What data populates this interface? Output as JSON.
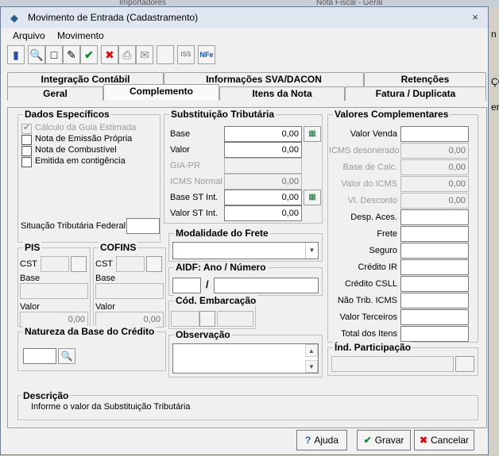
{
  "background": {
    "tabs": [
      "Importadores",
      "Nota Fiscal - Geral"
    ],
    "right_items": [
      "n",
      "ÇÕ",
      "en"
    ]
  },
  "window": {
    "title": "Movimento de Entrada (Cadastramento)",
    "close_glyph": "×"
  },
  "menu": {
    "items": [
      "Arquivo",
      "Movimento"
    ]
  },
  "toolbar": {
    "icons": [
      "book-icon",
      "search-icon",
      "new-document-icon",
      "edit-document-icon",
      "confirm-icon",
      "delete-icon",
      "print-icon",
      "mail-icon",
      "blank-icon",
      "iss-icon",
      "nfe-icon"
    ],
    "glyphs": [
      "▮",
      "🔍",
      "□",
      "✎",
      "✔",
      "✖",
      "⎙",
      "✉",
      "",
      "ISS",
      "NFe"
    ]
  },
  "tabs": {
    "row1": [
      "Integração Contábil",
      "Informações SVA/DACON",
      "Retenções"
    ],
    "row2": [
      "Geral",
      "Complemento",
      "Itens da Nota",
      "Fatura / Duplicata"
    ],
    "active": "Complemento"
  },
  "dados": {
    "title": "Dados Específicos",
    "checks": [
      {
        "label": "Cálculo da Guia Estimada",
        "checked": true,
        "disabled": true
      },
      {
        "label": "Nota de Emissão Própria",
        "checked": false,
        "disabled": false
      },
      {
        "label": "Nota de Combustível",
        "checked": false,
        "disabled": false
      },
      {
        "label": "Emitida em contigência",
        "checked": false,
        "disabled": false
      }
    ],
    "situacao_label": "Situação Tributária Federal",
    "situacao_value": ""
  },
  "pis": {
    "title": "PIS",
    "cst_label": "CST",
    "base_label": "Base",
    "valor_label": "Valor",
    "valor": "0,00"
  },
  "cofins": {
    "title": "COFINS",
    "cst_label": "CST",
    "base_label": "Base",
    "valor_label": "Valor",
    "valor": "0,00"
  },
  "natureza": {
    "title": "Natureza da Base do Crédito",
    "value": ""
  },
  "st": {
    "title": "Substituição Tributária",
    "rows": [
      {
        "label": "Base",
        "value": "0,00",
        "disabled": false,
        "calc": true
      },
      {
        "label": "Valor",
        "value": "0,00",
        "disabled": false,
        "calc": false
      },
      {
        "label": "GIA-PR",
        "value": "",
        "disabled": true,
        "calc": false
      },
      {
        "label": "ICMS Normal",
        "value": "0,00",
        "disabled": true,
        "calc": false
      },
      {
        "label": "Base ST Int.",
        "value": "0,00",
        "disabled": false,
        "calc": true
      },
      {
        "label": "Valor ST Int.",
        "value": "0,00",
        "disabled": false,
        "calc": false
      }
    ]
  },
  "frete": {
    "title": "Modalidade do Frete",
    "value": ""
  },
  "aidf": {
    "title": "AIDF:  Ano / Número",
    "separator": "/",
    "ano": "",
    "numero": ""
  },
  "embarcacao": {
    "title": "Cód. Embarcação"
  },
  "observacao": {
    "title": "Observação",
    "value": ""
  },
  "valores": {
    "title": "Valores Complementares",
    "rows": [
      {
        "label": "Valor Venda",
        "value": "",
        "disabled": false
      },
      {
        "label": "ICMS desonerado",
        "value": "0,00",
        "disabled": true
      },
      {
        "label": "Base de Calc.",
        "value": "0,00",
        "disabled": true
      },
      {
        "label": "Valor do ICMS",
        "value": "0,00",
        "disabled": true
      },
      {
        "label": "Vl. Desconto",
        "value": "0,00",
        "disabled": true
      },
      {
        "label": "Desp. Aces.",
        "value": "",
        "disabled": false
      },
      {
        "label": "Frete",
        "value": "",
        "disabled": false
      },
      {
        "label": "Seguro",
        "value": "",
        "disabled": false
      },
      {
        "label": "Crédito IR",
        "value": "",
        "disabled": false
      },
      {
        "label": "Crédito CSLL",
        "value": "",
        "disabled": false
      },
      {
        "label": "Não Trib. ICMS",
        "value": "",
        "disabled": false
      },
      {
        "label": "Valor Terceiros",
        "value": "",
        "disabled": false
      },
      {
        "label": "Total dos Itens",
        "value": "",
        "disabled": false
      }
    ]
  },
  "participacao": {
    "title": "Índ. Participação",
    "value": ""
  },
  "descricao": {
    "title": "Descrição",
    "text": "Informe o valor da Substituição Tributária"
  },
  "buttons": {
    "ajuda": "Ajuda",
    "gravar": "Gravar",
    "cancelar": "Cancelar",
    "ajuda_icon": "?",
    "gravar_icon": "✔",
    "cancelar_icon": "✖"
  },
  "colors": {
    "accent_green": "#0a8a2a",
    "cancel_red": "#d01010",
    "help_blue": "#2b5fb4"
  }
}
